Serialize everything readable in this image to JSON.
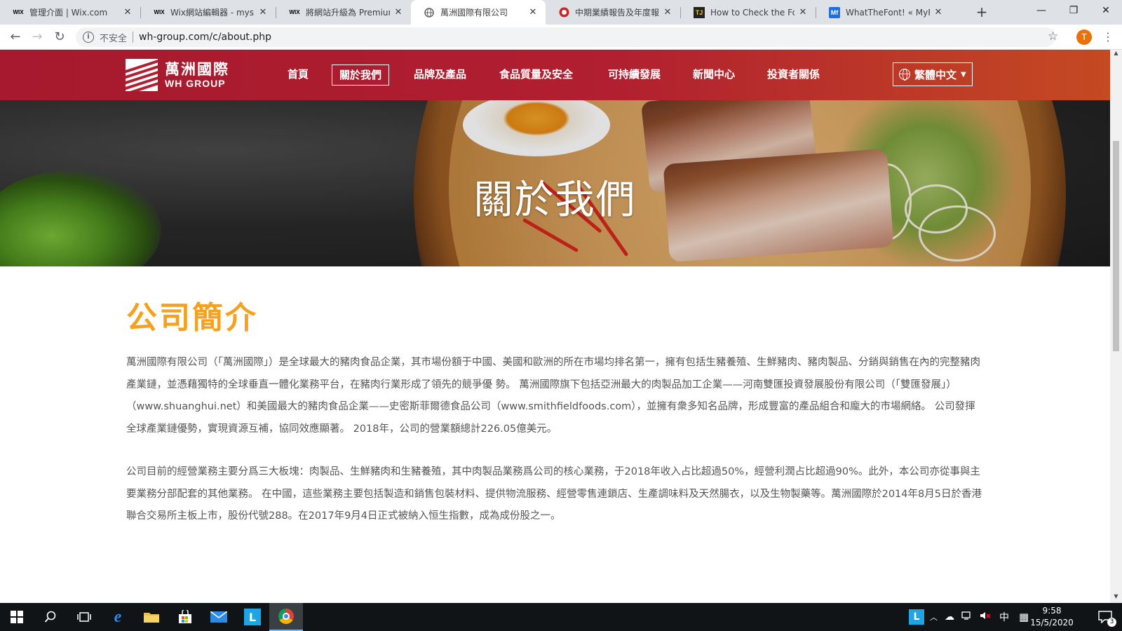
{
  "browser": {
    "tabs": [
      {
        "title": "管理介面 | Wix.com",
        "favicon": "WIX",
        "active": false
      },
      {
        "title": "Wix網站編輯器 - mysite",
        "favicon": "WIX",
        "active": false
      },
      {
        "title": "將網站升級為 Premium",
        "favicon": "WIX",
        "active": false
      },
      {
        "title": "萬洲國際有限公司",
        "favicon": "globe",
        "active": true
      },
      {
        "title": "中期業績報告及年度報告",
        "favicon": "red-seal",
        "active": false
      },
      {
        "title": "How to Check the Font",
        "favicon": "TJ",
        "active": false
      },
      {
        "title": "WhatTheFont! « MyFon",
        "favicon": "Mf",
        "active": false
      }
    ],
    "new_tab": "+",
    "window_controls": {
      "minimize": "—",
      "restore": "❐",
      "close": "✕"
    },
    "nav": {
      "back": "←",
      "forward": "→",
      "reload": "↻"
    },
    "address": {
      "security_label": "不安全",
      "url": "wh-group.com/c/about.php"
    },
    "profile_initial": "T"
  },
  "site": {
    "logo": {
      "cn": "萬洲國際",
      "en": "WH GROUP"
    },
    "nav": [
      {
        "label": "首頁",
        "active": false
      },
      {
        "label": "關於我們",
        "active": true
      },
      {
        "label": "品牌及產品",
        "active": false
      },
      {
        "label": "食品質量及安全",
        "active": false
      },
      {
        "label": "可持續發展",
        "active": false
      },
      {
        "label": "新聞中心",
        "active": false
      },
      {
        "label": "投資者關係",
        "active": false
      }
    ],
    "language": "繁體中文",
    "hero_title": "關於我們",
    "section_title": "公司簡介",
    "paragraphs": [
      "萬洲國際有限公司（「萬洲國際」）是全球最大的豬肉食品企業，其市場份額于中國、美國和歐洲的所在市場均排名第一，擁有包括生豬養殖、生鮮豬肉、豬肉製品、分銷與銷售在內的完整豬肉產業鏈，並憑藉獨特的全球垂直一體化業務平台，在豬肉行業形成了領先的競爭優 勢。 萬洲國際旗下包括亞洲最大的肉製品加工企業——河南雙匯投資發展股份有限公司（「雙匯發展」）（www.shuanghui.net）和美國最大的豬肉食品企業——史密斯菲爾德食品公司（www.smithfieldfoods.com），並擁有衆多知名品牌，形成豐富的產品組合和龐大的市場網絡。 公司發揮全球產業鏈優勢，實現資源互補，協同效應顯著。 2018年，公司的營業額總計226.05億美元。",
      "公司目前的經營業務主要分爲三大板塊：肉製品、生鮮豬肉和生豬養殖，其中肉製品業務爲公司的核心業務，于2018年收入占比超過50%，經營利潤占比超過90%。此外，本公司亦從事與主要業務分部配套的其他業務。 在中國，這些業務主要包括製造和銷售包裝材料、提供物流服務、經營零售連鎖店、生產調味料及天然腸衣，以及生物製藥等。萬洲國際於2014年8月5日於香港聯合交易所主板上市，股份代號288。在2017年9月4日正式被納入恒生指數，成為成份股之一。"
    ],
    "colors": {
      "header": "#a6192e",
      "accent": "#f5a11e",
      "text": "#555555"
    }
  },
  "taskbar": {
    "apps": [
      "windows-start-icon",
      "search-icon",
      "task-view-icon",
      "edge-icon",
      "file-explorer-icon",
      "store-icon",
      "mail-icon",
      "l-app-icon",
      "chrome-icon"
    ],
    "tray": {
      "ime": "中",
      "l_app": "L",
      "notifications": "3"
    },
    "clock": {
      "time": "9:58",
      "date": "15/5/2020"
    }
  }
}
